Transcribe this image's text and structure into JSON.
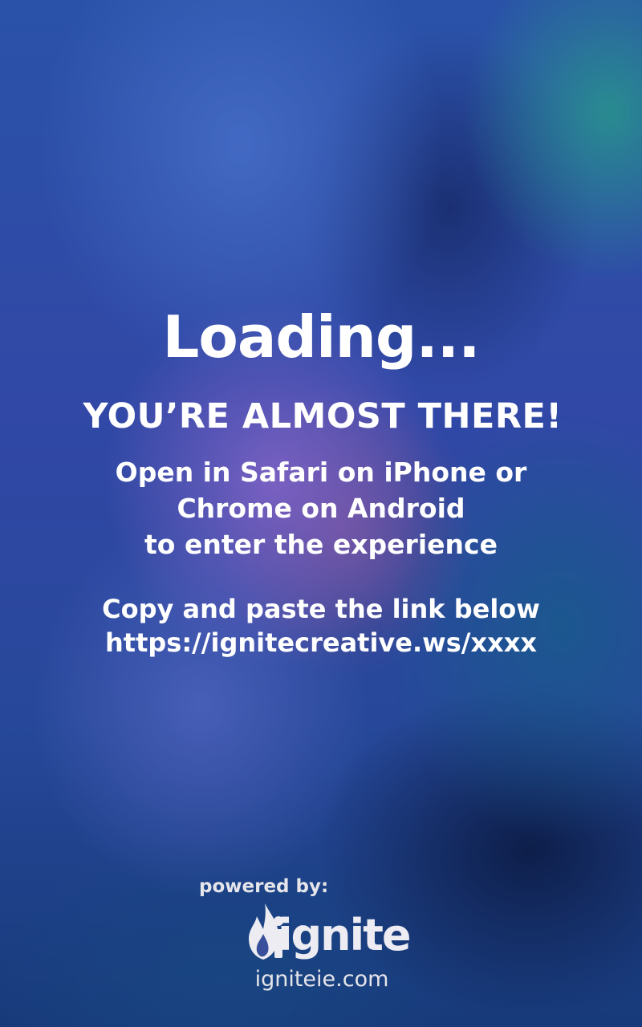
{
  "screen": {
    "loading_text": "Loading...",
    "headline": "YOU’RE ALMOST THERE!",
    "instructions": [
      "Open in Safari on iPhone or",
      "Chrome on Android",
      "to enter the experience"
    ],
    "copy_prompt": "Copy and paste the link below",
    "link": "https://ignitecreative.ws/xxxx"
  },
  "footer": {
    "powered_by": "powered by:",
    "brand_name": "ignite",
    "brand_logo_icon": "flame-icon",
    "website": "igniteie.com"
  },
  "colors": {
    "text": "#ffffff",
    "logo": "#ececf2",
    "background_primary": "#2a4aa0"
  }
}
